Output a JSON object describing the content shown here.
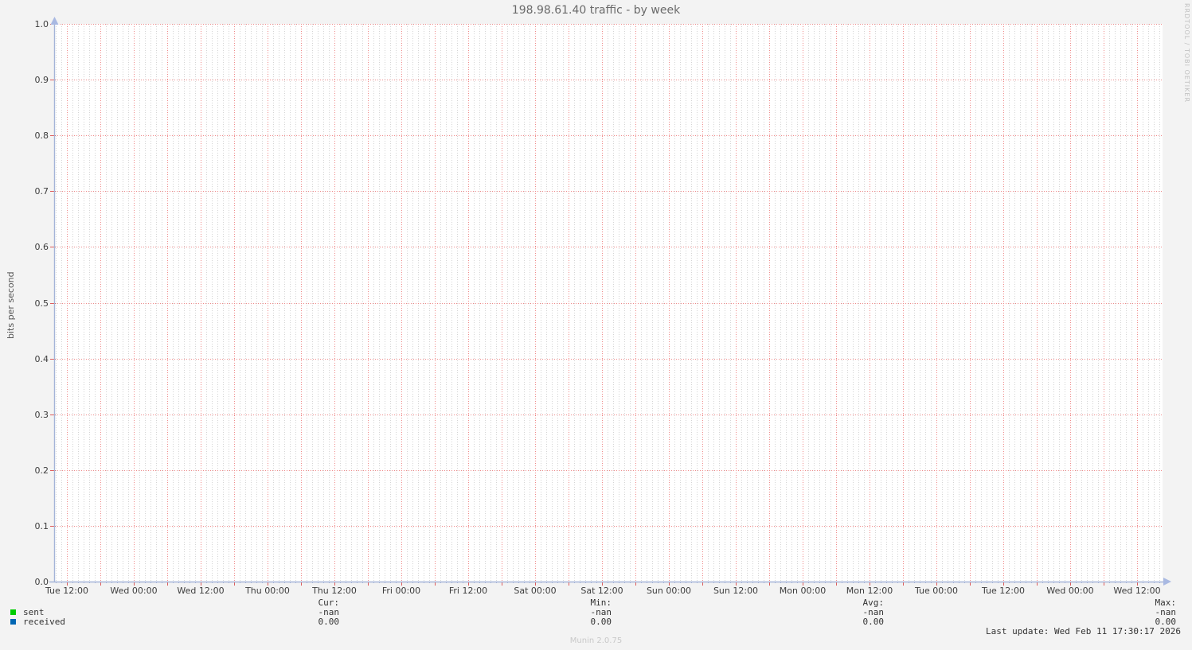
{
  "chart_data": {
    "type": "line",
    "title": "198.98.61.40 traffic - by week",
    "ylabel": "bits per second",
    "xlabel": "",
    "ylim": [
      0.0,
      1.0
    ],
    "grid": true,
    "legend_position": "bottom",
    "y_ticks": [
      "1.0",
      "0.9",
      "0.8",
      "0.7",
      "0.6",
      "0.5",
      "0.4",
      "0.3",
      "0.2",
      "0.1",
      "0.0"
    ],
    "x_ticks": [
      "Tue 12:00",
      "Wed 00:00",
      "Wed 12:00",
      "Thu 00:00",
      "Thu 12:00",
      "Fri 00:00",
      "Fri 12:00",
      "Sat 00:00",
      "Sat 12:00",
      "Sun 00:00",
      "Sun 12:00",
      "Mon 00:00",
      "Mon 12:00",
      "Tue 00:00",
      "Tue 12:00",
      "Wed 00:00",
      "Wed 12:00"
    ],
    "series": [
      {
        "name": "sent",
        "color": "#00cc00",
        "values": []
      },
      {
        "name": "received",
        "color": "#0066b3",
        "values": []
      }
    ],
    "legend_table": {
      "columns": [
        "Cur:",
        "Min:",
        "Avg:",
        "Max:"
      ],
      "rows": [
        {
          "label": "sent",
          "values": [
            "-nan",
            "-nan",
            "-nan",
            "-nan"
          ]
        },
        {
          "label": "received",
          "values": [
            "0.00",
            "0.00",
            "0.00",
            "0.00"
          ]
        }
      ]
    }
  },
  "footer": {
    "last_update": "Last update: Wed Feb 11 17:30:17 2026",
    "generator": "Munin 2.0.75"
  },
  "watermark": "RRDTOOL / TOBI OETIKER",
  "colors": {
    "background": "#f3f3f3",
    "canvas": "#ffffff",
    "major_grid": "#ef8a8a",
    "minor_grid": "#d4d4d4",
    "axis": "#a4b4d8",
    "arrow": "#a9b9e2",
    "tick_red": "#dd5c5c",
    "tick_minor": "#aab8da",
    "text": "#3d3d3d"
  }
}
